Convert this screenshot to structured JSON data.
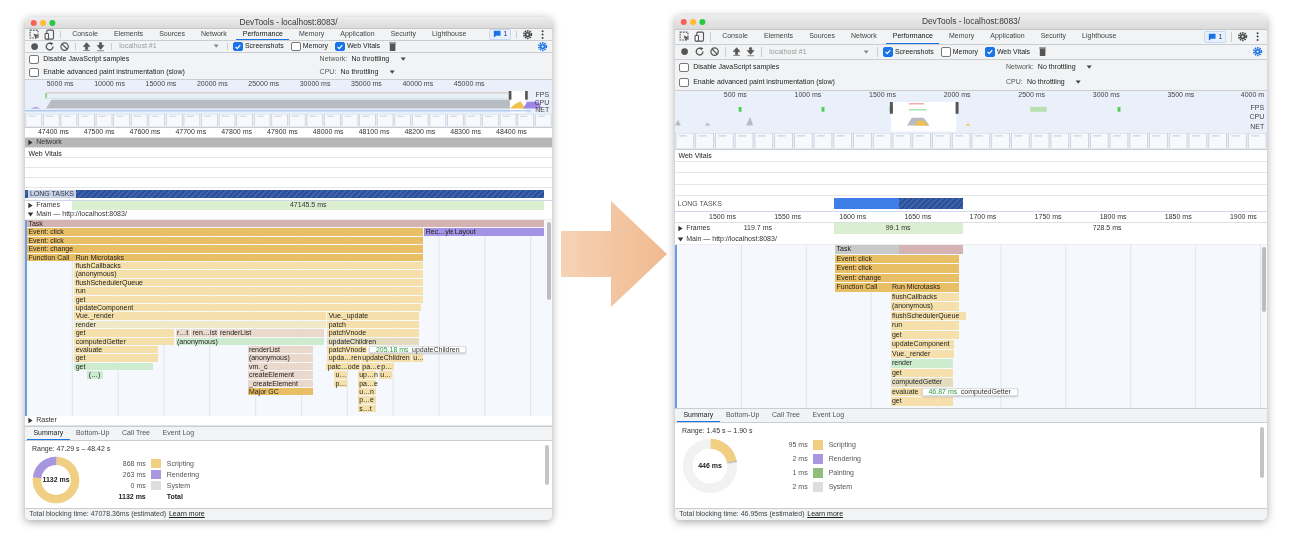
{
  "windows": [
    {
      "title": "DevTools - localhost:8083/",
      "tabs": [
        {
          "label": "Console",
          "selected": false
        },
        {
          "label": "Elements",
          "selected": false
        },
        {
          "label": "Sources",
          "selected": false
        },
        {
          "label": "Network",
          "selected": false
        },
        {
          "label": "Performance",
          "selected": true
        },
        {
          "label": "Memory",
          "selected": false
        },
        {
          "label": "Application",
          "selected": false
        },
        {
          "label": "Security",
          "selected": false
        },
        {
          "label": "Lighthouse",
          "selected": false
        }
      ],
      "issues_badge": "1",
      "recording": "localhost #1",
      "capture_options": [
        {
          "label": "Screenshots",
          "checked": true
        },
        {
          "label": "Memory",
          "checked": false
        },
        {
          "label": "Web Vitals",
          "checked": true
        }
      ],
      "options": [
        {
          "label": "Disable JavaScript samples",
          "checked": false
        },
        {
          "label": "Enable advanced paint instrumentation (slow)",
          "checked": false
        }
      ],
      "throttling": [
        {
          "label": "Network:",
          "value": "No throttling"
        },
        {
          "label": "CPU:",
          "value": "No throttling"
        }
      ],
      "overview": {
        "ticks": [
          "5000 ms",
          "10000 ms",
          "15000 ms",
          "20000 ms",
          "25000 ms",
          "30000 ms",
          "35000 ms",
          "40000 ms",
          "45000 ms"
        ],
        "lanes": [
          "FPS",
          "CPU",
          "NET"
        ]
      },
      "timeline": [
        {
          "kind": "ruler",
          "ticks": [
            "47400 ms",
            "47500 ms",
            "47600 ms",
            "47700 ms",
            "47800 ms",
            "47900 ms",
            "48000 ms",
            "48100 ms",
            "48200 ms",
            "48300 ms",
            "48400 ms"
          ]
        },
        {
          "kind": "track",
          "label": "Network",
          "expanded": false
        },
        {
          "kind": "vitals",
          "label": "Web Vitals"
        },
        {
          "kind": "long_tasks",
          "label": "LONG TASKS"
        },
        {
          "kind": "frames",
          "label": "Frames",
          "expanded": false,
          "values": [
            {
              "label": "47145.5 ms",
              "kind": "frame"
            }
          ]
        },
        {
          "kind": "main",
          "label": "Main — http://localhost:8083/",
          "expanded": true,
          "entries": [
            {
              "label": "Task",
              "kind": "task"
            },
            {
              "label": "Event: click",
              "kind": "event"
            },
            {
              "label": "Rec…yle",
              "kind": "layout"
            },
            {
              "label": "Layout",
              "kind": "layout"
            },
            {
              "label": "Event: click",
              "kind": "event"
            },
            {
              "label": "Event: change",
              "kind": "event"
            },
            {
              "label": "Function Call",
              "kind": "event"
            },
            {
              "label": "Run Microtasks",
              "kind": "event"
            },
            {
              "label": "flushCallbacks",
              "kind": "call"
            },
            {
              "label": "(anonymous)",
              "kind": "call"
            },
            {
              "label": "flushSchedulerQueue",
              "kind": "call"
            },
            {
              "label": "run",
              "kind": "call"
            },
            {
              "label": "get",
              "kind": "call"
            },
            {
              "label": "updateComponent",
              "kind": "call"
            },
            {
              "label": "Vue._render",
              "kind": "call"
            },
            {
              "label": "Vue._update",
              "kind": "call"
            },
            {
              "label": "render",
              "kind": "light"
            },
            {
              "label": "patch",
              "kind": "call"
            },
            {
              "label": "get",
              "kind": "call"
            },
            {
              "label": "r…t",
              "kind": "lib"
            },
            {
              "label": "ren…ist",
              "kind": "lib"
            },
            {
              "label": "renderList",
              "kind": "lib"
            },
            {
              "label": "patchVnode",
              "kind": "call"
            },
            {
              "label": "computedGetter",
              "kind": "call"
            },
            {
              "label": "(anonymous)",
              "kind": "render"
            },
            {
              "label": "updateChildren",
              "kind": "sel"
            },
            {
              "label": "evaluate",
              "kind": "call"
            },
            {
              "label": "renderList",
              "kind": "lib"
            },
            {
              "label": "patchVnode",
              "kind": "call"
            },
            {
              "label": "get",
              "kind": "call"
            },
            {
              "label": "(anonymous)",
              "kind": "lib"
            },
            {
              "label": "upda…ren",
              "kind": "call"
            },
            {
              "label": "updateChildren",
              "kind": "call"
            },
            {
              "label": "u…",
              "kind": "call"
            },
            {
              "label": "get",
              "kind": "render"
            },
            {
              "label": "vm._c",
              "kind": "lib"
            },
            {
              "label": "patc…ode",
              "kind": "call"
            },
            {
              "label": "pa…e",
              "kind": "call"
            },
            {
              "label": "p…",
              "kind": "call"
            },
            {
              "label": "(…)",
              "kind": "render"
            },
            {
              "label": "createElement",
              "kind": "lib"
            },
            {
              "label": "u…",
              "kind": "call"
            },
            {
              "label": "up…n",
              "kind": "call"
            },
            {
              "label": "u…",
              "kind": "call"
            },
            {
              "label": "_createElement",
              "kind": "lib"
            },
            {
              "label": "p…",
              "kind": "call"
            },
            {
              "label": "pa…e",
              "kind": "call"
            },
            {
              "label": "Major GC",
              "kind": "event"
            },
            {
              "label": "u…n",
              "kind": "call"
            },
            {
              "label": "p…e",
              "kind": "call"
            },
            {
              "label": "s…t",
              "kind": "call"
            }
          ],
          "tooltip": {
            "duration": "205.18 ms",
            "name": "updateChildren"
          }
        },
        {
          "kind": "track",
          "label": "Raster",
          "expanded": false
        }
      ],
      "bottom_tabs": [
        {
          "label": "Summary",
          "selected": true
        },
        {
          "label": "Bottom-Up",
          "selected": false
        },
        {
          "label": "Call Tree",
          "selected": false
        },
        {
          "label": "Event Log",
          "selected": false
        }
      ],
      "summary": {
        "range": "Range: 47.29 s – 48.42 s",
        "total": "1132 ms",
        "legend": [
          {
            "kind": "item",
            "value": "868 ms",
            "label": "Scripting",
            "color": "#f0cf82"
          },
          {
            "kind": "item",
            "value": "263 ms",
            "label": "Rendering",
            "color": "#a996e0"
          },
          {
            "kind": "item",
            "value": "0 ms",
            "label": "System",
            "color": "#dedede"
          },
          {
            "kind": "total",
            "value": "1132 ms",
            "label": "Total"
          }
        ]
      },
      "footer": {
        "text": "Total blocking time: 47078.36ms (estimated)",
        "link": "Learn more"
      }
    },
    {
      "title": "DevTools - localhost:8083/",
      "tabs": [
        {
          "label": "Console",
          "selected": false
        },
        {
          "label": "Elements",
          "selected": false
        },
        {
          "label": "Sources",
          "selected": false
        },
        {
          "label": "Network",
          "selected": false
        },
        {
          "label": "Performance",
          "selected": true
        },
        {
          "label": "Memory",
          "selected": false
        },
        {
          "label": "Application",
          "selected": false
        },
        {
          "label": "Security",
          "selected": false
        },
        {
          "label": "Lighthouse",
          "selected": false
        }
      ],
      "issues_badge": "1",
      "recording": "localhost #1",
      "capture_options": [
        {
          "label": "Screenshots",
          "checked": true
        },
        {
          "label": "Memory",
          "checked": false
        },
        {
          "label": "Web Vitals",
          "checked": true
        }
      ],
      "options": [
        {
          "label": "Disable JavaScript samples",
          "checked": false
        },
        {
          "label": "Enable advanced paint instrumentation (slow)",
          "checked": false
        }
      ],
      "throttling": [
        {
          "label": "Network:",
          "value": "No throttling"
        },
        {
          "label": "CPU:",
          "value": "No throttling"
        }
      ],
      "overview": {
        "ticks": [
          "500 ms",
          "1000 ms",
          "1500 ms",
          "2000 ms",
          "2500 ms",
          "3000 ms",
          "3500 ms",
          "4000 m"
        ],
        "lanes": [
          "FPS",
          "CPU",
          "NET"
        ]
      },
      "timeline": [
        {
          "kind": "vitals",
          "label": "Web Vitals"
        },
        {
          "kind": "long_tasks",
          "label": "LONG TASKS"
        },
        {
          "kind": "ruler",
          "ticks": [
            "1500 ms",
            "1550 ms",
            "1600 ms",
            "1650 ms",
            "1700 ms",
            "1750 ms",
            "1800 ms",
            "1850 ms",
            "1900 ms"
          ]
        },
        {
          "kind": "frames",
          "label": "Frames",
          "expanded": false,
          "values": [
            {
              "label": "119.7 ms",
              "kind": "plain"
            },
            {
              "label": "99.1 ms",
              "kind": "frame"
            },
            {
              "label": "728.5 ms",
              "kind": "plain"
            }
          ]
        },
        {
          "kind": "main",
          "label": "Main — http://localhost:8083/",
          "expanded": true,
          "entries": [
            {
              "label": "Task",
              "kind": "task"
            },
            {
              "label": "Event: click",
              "kind": "event"
            },
            {
              "label": "Event: click",
              "kind": "event"
            },
            {
              "label": "Event: change",
              "kind": "event"
            },
            {
              "label": "Function Call",
              "kind": "event"
            },
            {
              "label": "Run Microtasks",
              "kind": "event"
            },
            {
              "label": "flushCallbacks",
              "kind": "call"
            },
            {
              "label": "(anonymous)",
              "kind": "call"
            },
            {
              "label": "flushSchedulerQueue",
              "kind": "call"
            },
            {
              "label": "run",
              "kind": "call"
            },
            {
              "label": "get",
              "kind": "call"
            },
            {
              "label": "updateComponent",
              "kind": "call"
            },
            {
              "label": "Vue._render",
              "kind": "call"
            },
            {
              "label": "render",
              "kind": "render"
            },
            {
              "label": "get",
              "kind": "call"
            },
            {
              "label": "computedGetter",
              "kind": "sel"
            },
            {
              "label": "evaluate",
              "kind": "call"
            },
            {
              "label": "get",
              "kind": "call"
            }
          ],
          "tooltip": {
            "duration": "46.87 ms",
            "name": "computedGetter"
          }
        }
      ],
      "bottom_tabs": [
        {
          "label": "Summary",
          "selected": true
        },
        {
          "label": "Bottom-Up",
          "selected": false
        },
        {
          "label": "Call Tree",
          "selected": false
        },
        {
          "label": "Event Log",
          "selected": false
        }
      ],
      "summary": {
        "range": "Range: 1.45 s – 1.90 s",
        "total": "446 ms",
        "legend": [
          {
            "kind": "item",
            "value": "95 ms",
            "label": "Scripting",
            "color": "#f0cf82"
          },
          {
            "kind": "item",
            "value": "2 ms",
            "label": "Rendering",
            "color": "#a996e0"
          },
          {
            "kind": "item",
            "value": "1 ms",
            "label": "Painting",
            "color": "#8fbd7c"
          },
          {
            "kind": "item",
            "value": "2 ms",
            "label": "System",
            "color": "#dedede"
          }
        ]
      },
      "footer": {
        "text": "Total blocking time: 46.95ms (estimated)",
        "link": "Learn more"
      }
    }
  ]
}
